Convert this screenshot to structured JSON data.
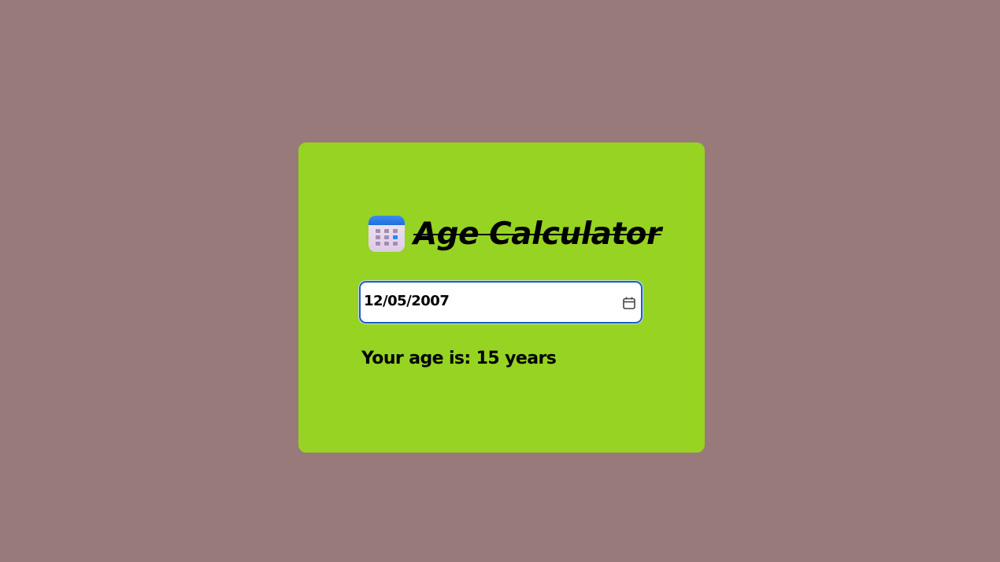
{
  "app": {
    "title": "Age Calculator",
    "title_icon": "calendar-icon"
  },
  "form": {
    "date_value": "12/05/2007",
    "picker_icon": "calendar-picker-icon"
  },
  "result": {
    "text": "Your age is: 15 years"
  },
  "colors": {
    "page_background": "#987a7a",
    "card_background": "#97d322",
    "input_border": "#1a5fc4"
  }
}
